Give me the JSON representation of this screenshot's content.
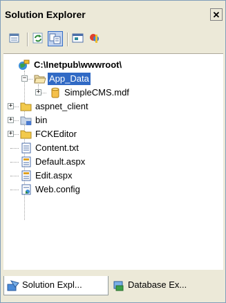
{
  "panel": {
    "title": "Solution Explorer",
    "close_glyph": "✕"
  },
  "toolbar": {
    "buttons": [
      {
        "name": "properties-icon"
      },
      {
        "name": "refresh-icon"
      },
      {
        "name": "show-all-files-icon"
      },
      {
        "name": "view-designer-icon"
      },
      {
        "name": "copy-website-icon"
      }
    ]
  },
  "tree": {
    "root": "C:\\Inetpub\\wwwroot\\",
    "items": [
      {
        "label": "App_Data",
        "icon": "folder-open-icon",
        "expander": "−"
      },
      {
        "label": "SimpleCMS.mdf",
        "icon": "database-icon",
        "expander": "+"
      },
      {
        "label": "aspnet_client",
        "icon": "folder-icon",
        "expander": "+"
      },
      {
        "label": "bin",
        "icon": "folder-icon",
        "expander": "+"
      },
      {
        "label": "FCKEditor",
        "icon": "folder-icon",
        "expander": "+"
      },
      {
        "label": "Content.txt",
        "icon": "text-file-icon"
      },
      {
        "label": "Default.aspx",
        "icon": "aspx-file-icon"
      },
      {
        "label": "Edit.aspx",
        "icon": "aspx-file-icon"
      },
      {
        "label": "Web.config",
        "icon": "config-file-icon"
      }
    ]
  },
  "tabs": [
    {
      "label": "Solution Expl...",
      "icon": "solution-explorer-icon",
      "active": true
    },
    {
      "label": "Database Ex...",
      "icon": "database-explorer-icon",
      "active": false
    }
  ],
  "colors": {
    "selection": "#316ac5",
    "chrome": "#ece9d8",
    "folder": "#f2c94c"
  }
}
